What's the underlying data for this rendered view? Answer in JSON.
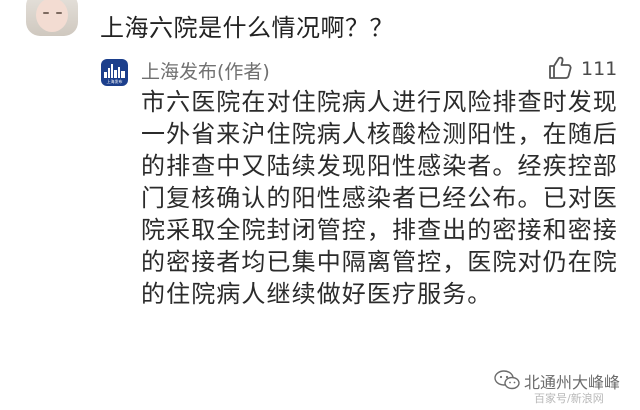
{
  "comment": {
    "text": "上海六院是什么情况啊？？"
  },
  "reply": {
    "author": "上海发布(作者)",
    "like_count": "111",
    "body": "市六医院在对住院病人进行风险排查时发现一外省来沪住院病人核酸检测阳性，在随后的排查中又陆续发现阳性感染者。经疾控部门复核确认的阳性感染者已经公布。已对医院采取全院封闭管控，排查出的密接和密接的密接者均已集中隔离管控，医院对仍在院的住院病人继续做好医疗服务。",
    "avatar_caption": "上海发布"
  },
  "watermark": {
    "name": "北通州大峰峰",
    "sub": "百家号/新浪网"
  },
  "icons": {
    "like": "thumbs-up-icon",
    "watermark": "wechat-icon"
  },
  "colors": {
    "background": "#ffffff",
    "text": "#2b2b2b",
    "muted": "#707070",
    "brand": "#1c3f8c"
  }
}
